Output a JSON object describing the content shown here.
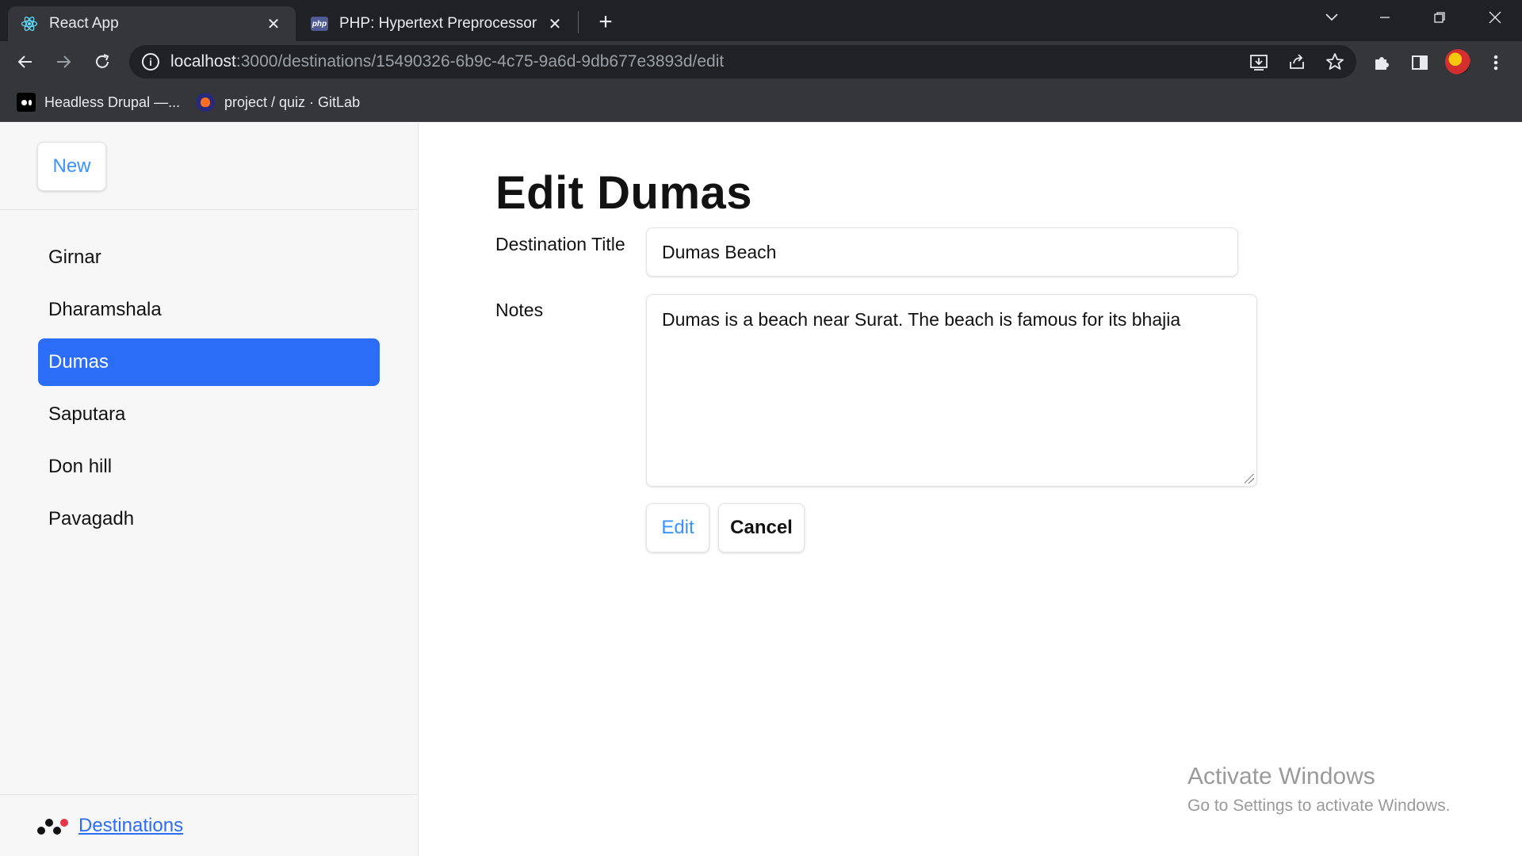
{
  "browser": {
    "tabs": [
      {
        "title": "React App",
        "icon": "react-icon",
        "active": true
      },
      {
        "title": "PHP: Hypertext Preprocessor",
        "icon": "php-icon",
        "favicon_text": "php",
        "active": false
      }
    ],
    "url_host": "localhost",
    "url_path": ":3000/destinations/15490326-6b9c-4c75-9a6d-9db677e3893d/edit",
    "bookmarks": [
      {
        "label": "Headless Drupal —...",
        "icon": "medium-icon"
      },
      {
        "label": "project / quiz · GitLab",
        "icon": "gitlab-icon"
      }
    ]
  },
  "sidebar": {
    "new_label": "New",
    "items": [
      {
        "label": "Girnar",
        "active": false
      },
      {
        "label": "Dharamshala",
        "active": false
      },
      {
        "label": "Dumas",
        "active": true
      },
      {
        "label": "Saputara",
        "active": false
      },
      {
        "label": "Don hill",
        "active": false
      },
      {
        "label": "Pavagadh",
        "active": false
      }
    ],
    "footer_link": "Destinations"
  },
  "main": {
    "title": "Edit Dumas",
    "form": {
      "title_label": "Destination Title",
      "title_value": "Dumas Beach",
      "notes_label": "Notes",
      "notes_value": "Dumas is a beach near Surat. The beach is famous for its bhajia"
    },
    "edit_label": "Edit",
    "cancel_label": "Cancel"
  },
  "watermark": {
    "title": "Activate Windows",
    "subtitle": "Go to Settings to activate Windows."
  },
  "colors": {
    "accent": "#3992ff",
    "active_item": "#2b6df7",
    "browser_dark": "#202124",
    "browser_toolbar": "#35363a"
  }
}
